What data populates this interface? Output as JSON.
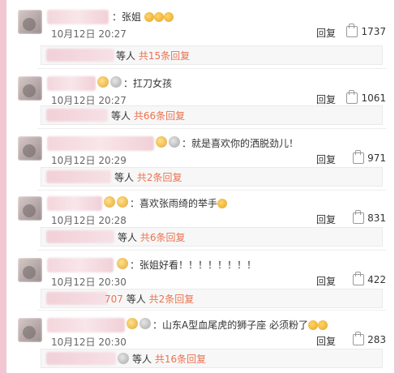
{
  "comments": [
    {
      "text": "：张姐",
      "date": "10月12日 20:27",
      "reply_label": "回复",
      "likes": "1737",
      "sub": {
        "equals": "等人",
        "count": "共15条回复"
      }
    },
    {
      "text": "：扛刀女孩",
      "date": "10月12日 20:27",
      "reply_label": "回复",
      "likes": "1061",
      "sub": {
        "equals": "等人",
        "count": "共66条回复"
      }
    },
    {
      "text": "：就是喜欢你的洒脱劲儿！",
      "date": "10月12日 20:29",
      "reply_label": "回复",
      "likes": "971",
      "sub": {
        "equals": "等人",
        "count": "共2条回复"
      }
    },
    {
      "text": "：喜欢张雨绮的举手",
      "date": "10月12日 20:28",
      "reply_label": "回复",
      "likes": "831",
      "sub": {
        "equals": "等人",
        "count": "共6条回复"
      }
    },
    {
      "text": "：张姐好看！！！！！！！！",
      "date": "10月12日 20:30",
      "reply_label": "回复",
      "likes": "422",
      "sub": {
        "prefix": "707",
        "equals": "等人",
        "count": "共2条回复"
      }
    },
    {
      "text": "：山东A型血尾虎的狮子座 必须粉了",
      "date": "10月12日 20:30",
      "reply_label": "回复",
      "likes": "283",
      "sub": {
        "equals": "等人",
        "count": "共16条回复"
      }
    }
  ]
}
